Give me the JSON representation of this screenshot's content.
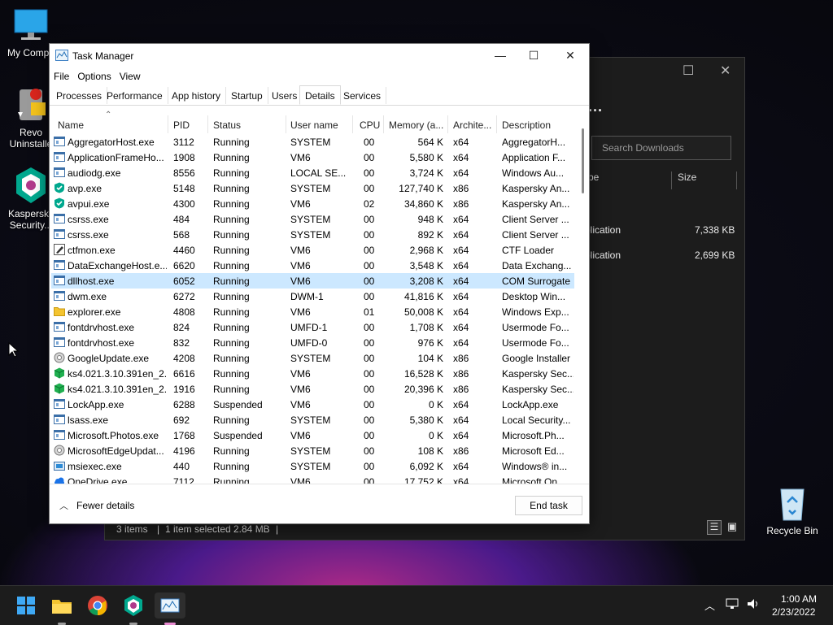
{
  "desktop": {
    "icons": [
      {
        "label": "My Compu",
        "icon": "computer-icon"
      },
      {
        "label": "Revo",
        "label2": "Uninstalle",
        "icon": "revo-uninstaller-icon"
      },
      {
        "label": "Kaspersky",
        "label2": "Security...",
        "icon": "kaspersky-icon"
      },
      {
        "label": "Recycle Bin",
        "icon": "recycle-bin-icon"
      }
    ]
  },
  "explorer": {
    "search_placeholder": "Search Downloads",
    "more_label": "...",
    "columns": [
      "pe",
      "Size"
    ],
    "rows": [
      {
        "type": "plication",
        "size": "7,338 KB"
      },
      {
        "type": "plication",
        "size": "2,699 KB"
      }
    ],
    "status": {
      "items": "3 items",
      "selected": "1 item selected",
      "size": "2.84 MB"
    }
  },
  "task_manager": {
    "title": "Task Manager",
    "menu": [
      "File",
      "Options",
      "View"
    ],
    "tabs": [
      "Processes",
      "Performance",
      "App history",
      "Startup",
      "Users",
      "Details",
      "Services"
    ],
    "active_tab": "Details",
    "columns": [
      "Name",
      "PID",
      "Status",
      "User name",
      "CPU",
      "Memory (a...",
      "Archite...",
      "Description"
    ],
    "rows": [
      {
        "name": "AggregatorHost.exe",
        "pid": "3112",
        "status": "Running",
        "user": "SYSTEM",
        "cpu": "00",
        "mem": "564 K",
        "arch": "x64",
        "desc": "AggregatorH...",
        "icon": "window-icon"
      },
      {
        "name": "ApplicationFrameHo...",
        "pid": "1908",
        "status": "Running",
        "user": "VM6",
        "cpu": "00",
        "mem": "5,580 K",
        "arch": "x64",
        "desc": "Application F...",
        "icon": "window-icon"
      },
      {
        "name": "audiodg.exe",
        "pid": "8556",
        "status": "Running",
        "user": "LOCAL SE...",
        "cpu": "00",
        "mem": "3,724 K",
        "arch": "x64",
        "desc": "Windows Au...",
        "icon": "window-icon"
      },
      {
        "name": "avp.exe",
        "pid": "5148",
        "status": "Running",
        "user": "SYSTEM",
        "cpu": "00",
        "mem": "127,740 K",
        "arch": "x86",
        "desc": "Kaspersky An...",
        "icon": "shield-check-icon"
      },
      {
        "name": "avpui.exe",
        "pid": "4300",
        "status": "Running",
        "user": "VM6",
        "cpu": "02",
        "mem": "34,860 K",
        "arch": "x86",
        "desc": "Kaspersky An...",
        "icon": "shield-check-icon"
      },
      {
        "name": "csrss.exe",
        "pid": "484",
        "status": "Running",
        "user": "SYSTEM",
        "cpu": "00",
        "mem": "948 K",
        "arch": "x64",
        "desc": "Client Server ...",
        "icon": "window-icon"
      },
      {
        "name": "csrss.exe",
        "pid": "568",
        "status": "Running",
        "user": "SYSTEM",
        "cpu": "00",
        "mem": "892 K",
        "arch": "x64",
        "desc": "Client Server ...",
        "icon": "window-icon"
      },
      {
        "name": "ctfmon.exe",
        "pid": "4460",
        "status": "Running",
        "user": "VM6",
        "cpu": "00",
        "mem": "2,968 K",
        "arch": "x64",
        "desc": "CTF Loader",
        "icon": "pen-icon"
      },
      {
        "name": "DataExchangeHost.e...",
        "pid": "6620",
        "status": "Running",
        "user": "VM6",
        "cpu": "00",
        "mem": "3,548 K",
        "arch": "x64",
        "desc": "Data Exchang...",
        "icon": "window-icon"
      },
      {
        "name": "dllhost.exe",
        "pid": "6052",
        "status": "Running",
        "user": "VM6",
        "cpu": "00",
        "mem": "3,208 K",
        "arch": "x64",
        "desc": "COM Surrogate",
        "icon": "window-icon"
      },
      {
        "name": "dwm.exe",
        "pid": "6272",
        "status": "Running",
        "user": "DWM-1",
        "cpu": "00",
        "mem": "41,816 K",
        "arch": "x64",
        "desc": "Desktop Win...",
        "icon": "window-icon"
      },
      {
        "name": "explorer.exe",
        "pid": "4808",
        "status": "Running",
        "user": "VM6",
        "cpu": "01",
        "mem": "50,008 K",
        "arch": "x64",
        "desc": "Windows Exp...",
        "icon": "folder-icon"
      },
      {
        "name": "fontdrvhost.exe",
        "pid": "824",
        "status": "Running",
        "user": "UMFD-1",
        "cpu": "00",
        "mem": "1,708 K",
        "arch": "x64",
        "desc": "Usermode Fo...",
        "icon": "window-icon"
      },
      {
        "name": "fontdrvhost.exe",
        "pid": "832",
        "status": "Running",
        "user": "UMFD-0",
        "cpu": "00",
        "mem": "976 K",
        "arch": "x64",
        "desc": "Usermode Fo...",
        "icon": "window-icon"
      },
      {
        "name": "GoogleUpdate.exe",
        "pid": "4208",
        "status": "Running",
        "user": "SYSTEM",
        "cpu": "00",
        "mem": "104 K",
        "arch": "x86",
        "desc": "Google Installer",
        "icon": "gear-icon"
      },
      {
        "name": "ks4.021.3.10.391en_2...",
        "pid": "6616",
        "status": "Running",
        "user": "VM6",
        "cpu": "00",
        "mem": "16,528 K",
        "arch": "x86",
        "desc": "Kaspersky Sec...",
        "icon": "green-cube-icon"
      },
      {
        "name": "ks4.021.3.10.391en_2...",
        "pid": "1916",
        "status": "Running",
        "user": "VM6",
        "cpu": "00",
        "mem": "20,396 K",
        "arch": "x86",
        "desc": "Kaspersky Sec...",
        "icon": "green-cube-icon"
      },
      {
        "name": "LockApp.exe",
        "pid": "6288",
        "status": "Suspended",
        "user": "VM6",
        "cpu": "00",
        "mem": "0 K",
        "arch": "x64",
        "desc": "LockApp.exe",
        "icon": "window-icon"
      },
      {
        "name": "lsass.exe",
        "pid": "692",
        "status": "Running",
        "user": "SYSTEM",
        "cpu": "00",
        "mem": "5,380 K",
        "arch": "x64",
        "desc": "Local Security...",
        "icon": "window-icon"
      },
      {
        "name": "Microsoft.Photos.exe",
        "pid": "1768",
        "status": "Suspended",
        "user": "VM6",
        "cpu": "00",
        "mem": "0 K",
        "arch": "x64",
        "desc": "Microsoft.Ph...",
        "icon": "window-icon"
      },
      {
        "name": "MicrosoftEdgeUpdat...",
        "pid": "4196",
        "status": "Running",
        "user": "SYSTEM",
        "cpu": "00",
        "mem": "108 K",
        "arch": "x86",
        "desc": "Microsoft Ed...",
        "icon": "gear-icon"
      },
      {
        "name": "msiexec.exe",
        "pid": "440",
        "status": "Running",
        "user": "SYSTEM",
        "cpu": "00",
        "mem": "6,092 K",
        "arch": "x64",
        "desc": "Windows® in...",
        "icon": "installer-icon"
      },
      {
        "name": "OneDrive.exe",
        "pid": "7112",
        "status": "Running",
        "user": "VM6",
        "cpu": "00",
        "mem": "17,752 K",
        "arch": "x64",
        "desc": "Microsoft On...",
        "icon": "cloud-icon"
      }
    ],
    "selected_row": 9,
    "fewer_details": "Fewer details",
    "end_task": "End task"
  },
  "taskbar": {
    "apps": [
      "start-icon",
      "file-explorer-icon",
      "chrome-icon",
      "kaspersky-icon",
      "task-manager-icon"
    ],
    "time": "1:00 AM",
    "date": "2/23/2022"
  }
}
